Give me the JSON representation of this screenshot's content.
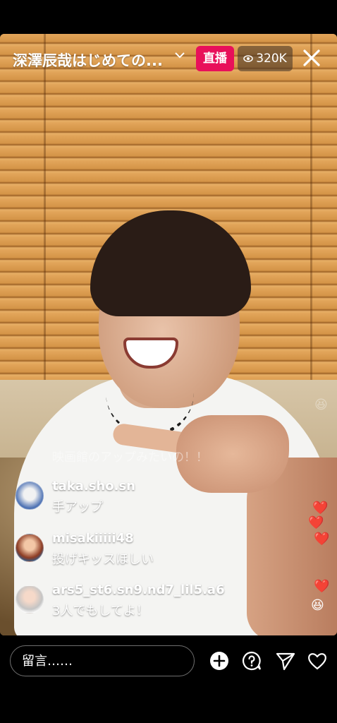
{
  "header": {
    "title": "深澤辰哉はじめての...",
    "live_label": "直播",
    "viewer_count": "320K",
    "accent_color": "#e8105a"
  },
  "ghost_comment": "映画館のアップみたいの！！",
  "comments": [
    {
      "user": "taka.sho.sn",
      "text": "手アップ"
    },
    {
      "user": "misakiiiii48",
      "text": "投げキッスほしい"
    },
    {
      "user": "ars5_st6.sn9.nd7_lil5.a6",
      "text": "3人でもしてよ！"
    }
  ],
  "reactions": [
    "❤️",
    "❤️",
    "❤️",
    "❤️",
    "😆",
    "😆"
  ],
  "bottom_bar": {
    "input_placeholder": "留言……",
    "icons": [
      "add-icon",
      "question-icon",
      "send-icon",
      "heart-icon"
    ]
  }
}
